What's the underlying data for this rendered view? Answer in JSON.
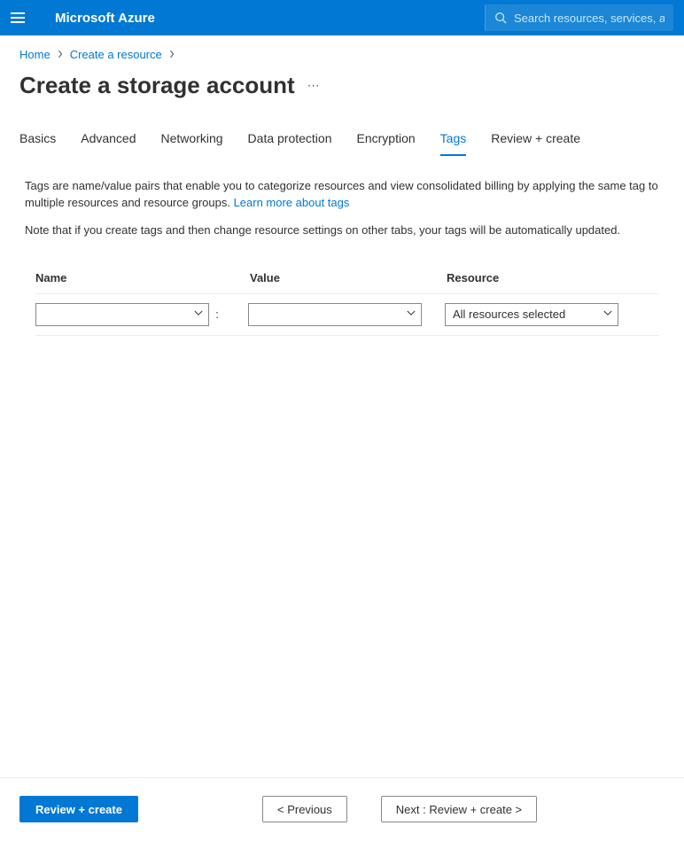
{
  "header": {
    "brand": "Microsoft Azure",
    "search_placeholder": "Search resources, services, and d"
  },
  "breadcrumb": {
    "items": [
      "Home",
      "Create a resource"
    ]
  },
  "page": {
    "title": "Create a storage account"
  },
  "tabs": {
    "items": [
      {
        "label": "Basics",
        "active": false
      },
      {
        "label": "Advanced",
        "active": false
      },
      {
        "label": "Networking",
        "active": false
      },
      {
        "label": "Data protection",
        "active": false
      },
      {
        "label": "Encryption",
        "active": false
      },
      {
        "label": "Tags",
        "active": true
      },
      {
        "label": "Review + create",
        "active": false
      }
    ]
  },
  "description": {
    "para1_prefix": "Tags are name/value pairs that enable you to categorize resources and view consolidated billing by applying the same tag to multiple resources and resource groups. ",
    "learn_link": "Learn more about tags",
    "para2": "Note that if you create tags and then change resource settings on other tabs, your tags will be automatically updated."
  },
  "tag_table": {
    "headers": {
      "name": "Name",
      "value": "Value",
      "resource": "Resource"
    },
    "row": {
      "name_value": "",
      "separator": ":",
      "value_value": "",
      "resource_value": "All resources selected"
    }
  },
  "footer": {
    "review_create": "Review + create",
    "previous": "< Previous",
    "next": "Next : Review + create >"
  }
}
